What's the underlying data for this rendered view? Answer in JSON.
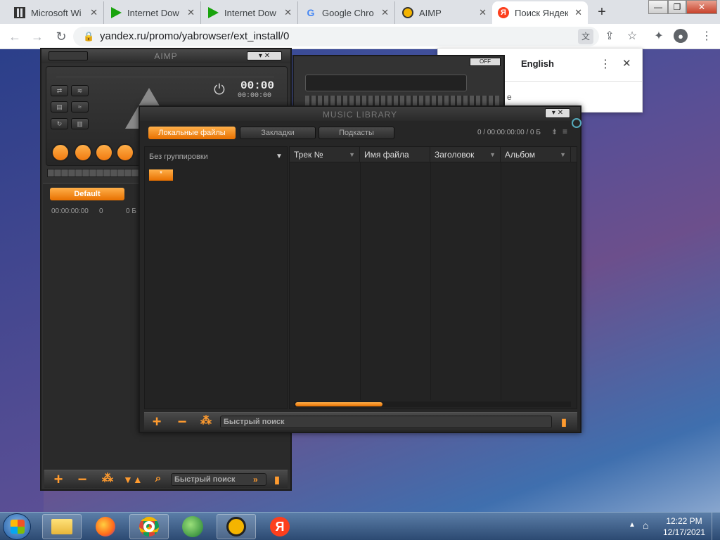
{
  "browser": {
    "tabs": [
      {
        "label": "Microsoft Wi",
        "icon": "columns-icon"
      },
      {
        "label": "Internet Dow",
        "icon": "idm-play-icon"
      },
      {
        "label": "Internet Dow",
        "icon": "idm-play-icon"
      },
      {
        "label": "Google Chro",
        "icon": "google-icon"
      },
      {
        "label": "AIMP",
        "icon": "aimp-icon"
      },
      {
        "label": "Поиск Яндек",
        "icon": "yandex-icon"
      }
    ],
    "new_tab": "+",
    "url": "yandex.ru/promo/yabrowser/ext_install/0",
    "window_controls": {
      "minimize": "—",
      "restore": "❐",
      "close": "✕"
    }
  },
  "translate_popup": {
    "language": "English",
    "menu": "⋮",
    "close": "✕",
    "partial_text": "e"
  },
  "aimp": {
    "title": "AIMP",
    "time": "00:00",
    "time_small": "00:00:00",
    "playlist_tab": "Default",
    "playlist_info": {
      "duration": "00:00:00:00",
      "count": "0",
      "size": "0 Б"
    },
    "search_placeholder": "Быстрый поиск"
  },
  "equalizer": {
    "off_label": "OFF"
  },
  "library": {
    "title": "MUSIC LIBRARY",
    "tabs": [
      "Локальные файлы",
      "Закладки",
      "Подкасты"
    ],
    "stats": "0 / 00:00:00:00 / 0 Б",
    "grouping": "Без группировки",
    "tree_item": "*",
    "columns": [
      "Трек №",
      "Имя файла",
      "Заголовок",
      "Альбом"
    ],
    "search_placeholder": "Быстрый поиск"
  },
  "taskbar": {
    "time": "12:22 PM",
    "date": "12/17/2021",
    "show_hidden": "▲",
    "apps": [
      "explorer",
      "firefox",
      "chrome",
      "idm",
      "aimp",
      "yandex"
    ]
  },
  "colors": {
    "accent": "#f28a1c",
    "aimp_bg": "#2b2b2b",
    "chrome_tabbar": "#dee1e6"
  }
}
